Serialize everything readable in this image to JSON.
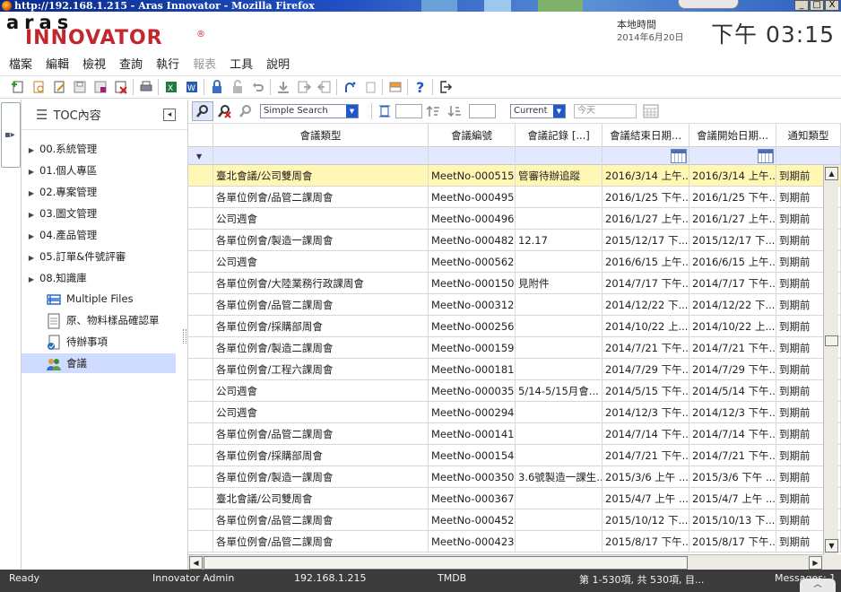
{
  "window": {
    "title": "http://192.168.1.215 - Aras Innovator - Mozilla Firefox",
    "controls": [
      "_",
      "□",
      "X"
    ]
  },
  "header": {
    "logo_top": "aras",
    "logo_main": "INNOVATOR",
    "logo_reg": "®",
    "clock_label": "本地時間",
    "clock_date": "2014年6月20日",
    "clock_time": "下午 03:15"
  },
  "menu": [
    {
      "label": "檔案",
      "enabled": true
    },
    {
      "label": "編輯",
      "enabled": true
    },
    {
      "label": "檢視",
      "enabled": true
    },
    {
      "label": "查詢",
      "enabled": true
    },
    {
      "label": "執行",
      "enabled": true
    },
    {
      "label": "報表",
      "enabled": false
    },
    {
      "label": "工具",
      "enabled": true
    },
    {
      "label": "說明",
      "enabled": true
    }
  ],
  "toc": {
    "title": "TOC內容",
    "folders": [
      "00.系統管理",
      "01.個人專區",
      "02.專案管理",
      "03.圖文管理",
      "04.產品管理",
      "05.訂單&件號評審",
      "08.知識庫"
    ],
    "items": [
      {
        "label": "Multiple Files",
        "icon": "multiple-files-icon"
      },
      {
        "label": "原、物料樣品確認單",
        "icon": "form-icon"
      },
      {
        "label": "待辦事項",
        "icon": "todo-icon"
      },
      {
        "label": "會議",
        "icon": "meeting-icon",
        "selected": true
      }
    ]
  },
  "grid_toolbar": {
    "search_mode": "Simple Search",
    "version_filter": "Current",
    "date_placeholder": "今天"
  },
  "grid": {
    "columns": [
      "會議類型",
      "會議編號",
      "會議記錄 [...]",
      "會議結束日期...",
      "會議開始日期...",
      "通知類型"
    ],
    "rows": [
      [
        "臺北會議/公司雙周會",
        "MeetNo-000515",
        "管審待辦追蹤",
        "2016/3/14 上午...",
        "2016/3/14 上午...",
        "到期前"
      ],
      [
        "各單位例會/品管二課周會",
        "MeetNo-000495",
        "",
        "2016/1/25 下午...",
        "2016/1/25 下午...",
        "到期前"
      ],
      [
        "公司週會",
        "MeetNo-000496",
        "",
        "2016/1/27 上午...",
        "2016/1/27 上午...",
        "到期前"
      ],
      [
        "各單位例會/製造一課周會",
        "MeetNo-000482",
        "12.17",
        "2015/12/17 下...",
        "2015/12/17 下...",
        "到期前"
      ],
      [
        "公司週會",
        "MeetNo-000562",
        "",
        "2016/6/15 上午...",
        "2016/6/15 上午...",
        "到期前"
      ],
      [
        "各單位例會/大陸業務行政課周會",
        "MeetNo-000150",
        "見附件",
        "2014/7/17 下午...",
        "2014/7/17 下午...",
        "到期前"
      ],
      [
        "各單位例會/品管二課周會",
        "MeetNo-000312",
        "",
        "2014/12/22 下...",
        "2014/12/22 下...",
        "到期前"
      ],
      [
        "各單位例會/採購部周會",
        "MeetNo-000256",
        "",
        "2014/10/22 上...",
        "2014/10/22 上...",
        "到期前"
      ],
      [
        "各單位例會/製造二課周會",
        "MeetNo-000159",
        "",
        "2014/7/21 下午...",
        "2014/7/21 下午...",
        "到期前"
      ],
      [
        "各單位例會/工程六課周會",
        "MeetNo-000181",
        "",
        "2014/7/29 下午...",
        "2014/7/29 下午...",
        "到期前"
      ],
      [
        "公司週會",
        "MeetNo-000035",
        "5/14-5/15月會...",
        "2014/5/15 下午...",
        "2014/5/14 下午...",
        "到期前"
      ],
      [
        "公司週會",
        "MeetNo-000294",
        "",
        "2014/12/3 下午...",
        "2014/12/3 下午...",
        "到期前"
      ],
      [
        "各單位例會/品管二課周會",
        "MeetNo-000141",
        "",
        "2014/7/14 下午...",
        "2014/7/14 下午...",
        "到期前"
      ],
      [
        "各單位例會/採購部周會",
        "MeetNo-000154",
        "",
        "2014/7/21 下午...",
        "2014/7/21 下午...",
        "到期前"
      ],
      [
        "各單位例會/製造一課周會",
        "MeetNo-000350",
        "3.6號製造一課生...",
        "2015/3/6 上午 ...",
        "2015/3/6 下午 ...",
        "到期前"
      ],
      [
        "臺北會議/公司雙周會",
        "MeetNo-000367",
        "",
        "2015/4/7 上午 ...",
        "2015/4/7 上午 ...",
        "到期前"
      ],
      [
        "各單位例會/品管二課周會",
        "MeetNo-000452",
        "",
        "2015/10/12 下...",
        "2015/10/13 下...",
        "到期前"
      ],
      [
        "各單位例會/品管二課周會",
        "MeetNo-000423",
        "",
        "2015/8/17 下午...",
        "2015/8/17 下午...",
        "到期前"
      ]
    ],
    "selected_row": 0
  },
  "status": {
    "state": "Ready",
    "user": "Innovator Admin",
    "server": "192.168.1.215",
    "database": "TMDB",
    "items": "第 1-530項, 共 530項, 目...",
    "messages": "Messages: 1"
  },
  "colors": {
    "accent_red": "#c2272d",
    "selected_row": "#fff7b3",
    "filter_row": "#e3e8ff",
    "status_bar": "#3b3b3b"
  }
}
